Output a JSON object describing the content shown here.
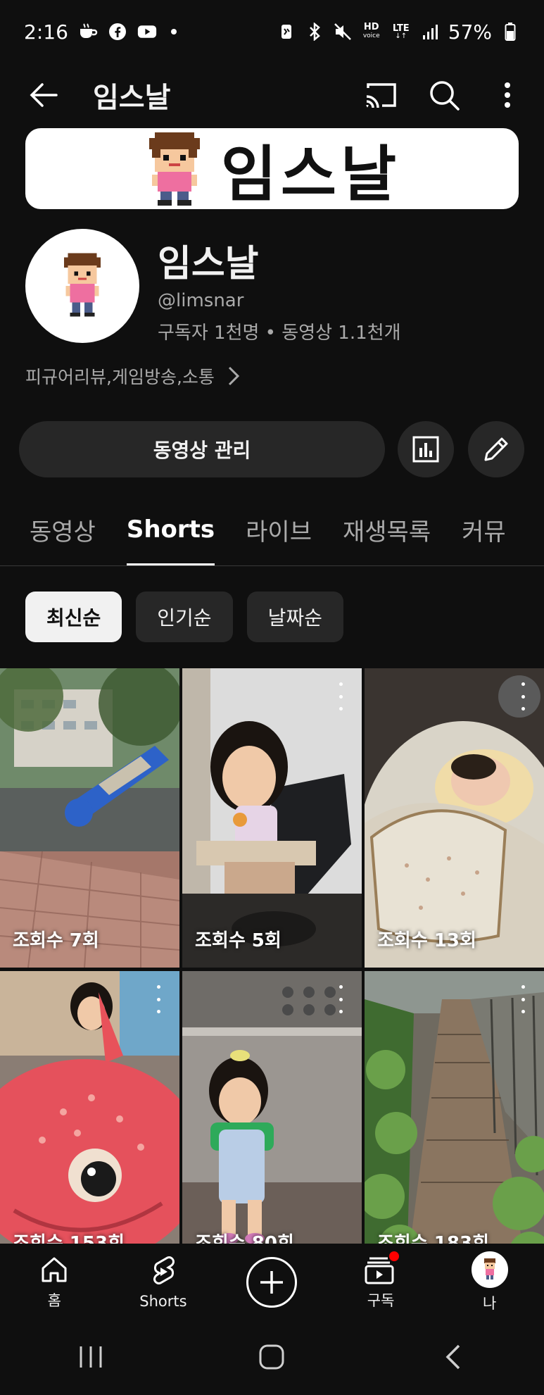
{
  "status_bar": {
    "time": "2:16",
    "battery": "57%",
    "hd_label": "HD",
    "voice_label": "voice",
    "lte_label": "LTE"
  },
  "header": {
    "title": "임스날"
  },
  "banner": {
    "text": "임스날"
  },
  "channel": {
    "name": "임스날",
    "handle": "@limsnar",
    "stats": "구독자 1천명 • 동영상 1.1천개",
    "description": "피규어리뷰,게임방송,소통"
  },
  "actions": {
    "manage_label": "동영상 관리"
  },
  "tabs": [
    {
      "label": "동영상"
    },
    {
      "label": "Shorts"
    },
    {
      "label": "라이브"
    },
    {
      "label": "재생목록"
    },
    {
      "label": "커뮤"
    }
  ],
  "chips": [
    {
      "label": "최신순"
    },
    {
      "label": "인기순"
    },
    {
      "label": "날짜순"
    }
  ],
  "shorts": [
    {
      "views": "조회수 7회"
    },
    {
      "views": "조회수 5회"
    },
    {
      "views": "조회수 13회"
    },
    {
      "views": "조회수 153회"
    },
    {
      "views": "조회수 80회"
    },
    {
      "views": "조회수 183회"
    }
  ],
  "bottom_nav": {
    "home": "홈",
    "shorts": "Shorts",
    "subscriptions": "구독",
    "me": "나"
  },
  "colors": {
    "background": "#0f0f0f",
    "surface": "#272727",
    "accent_red": "#ff0000"
  }
}
